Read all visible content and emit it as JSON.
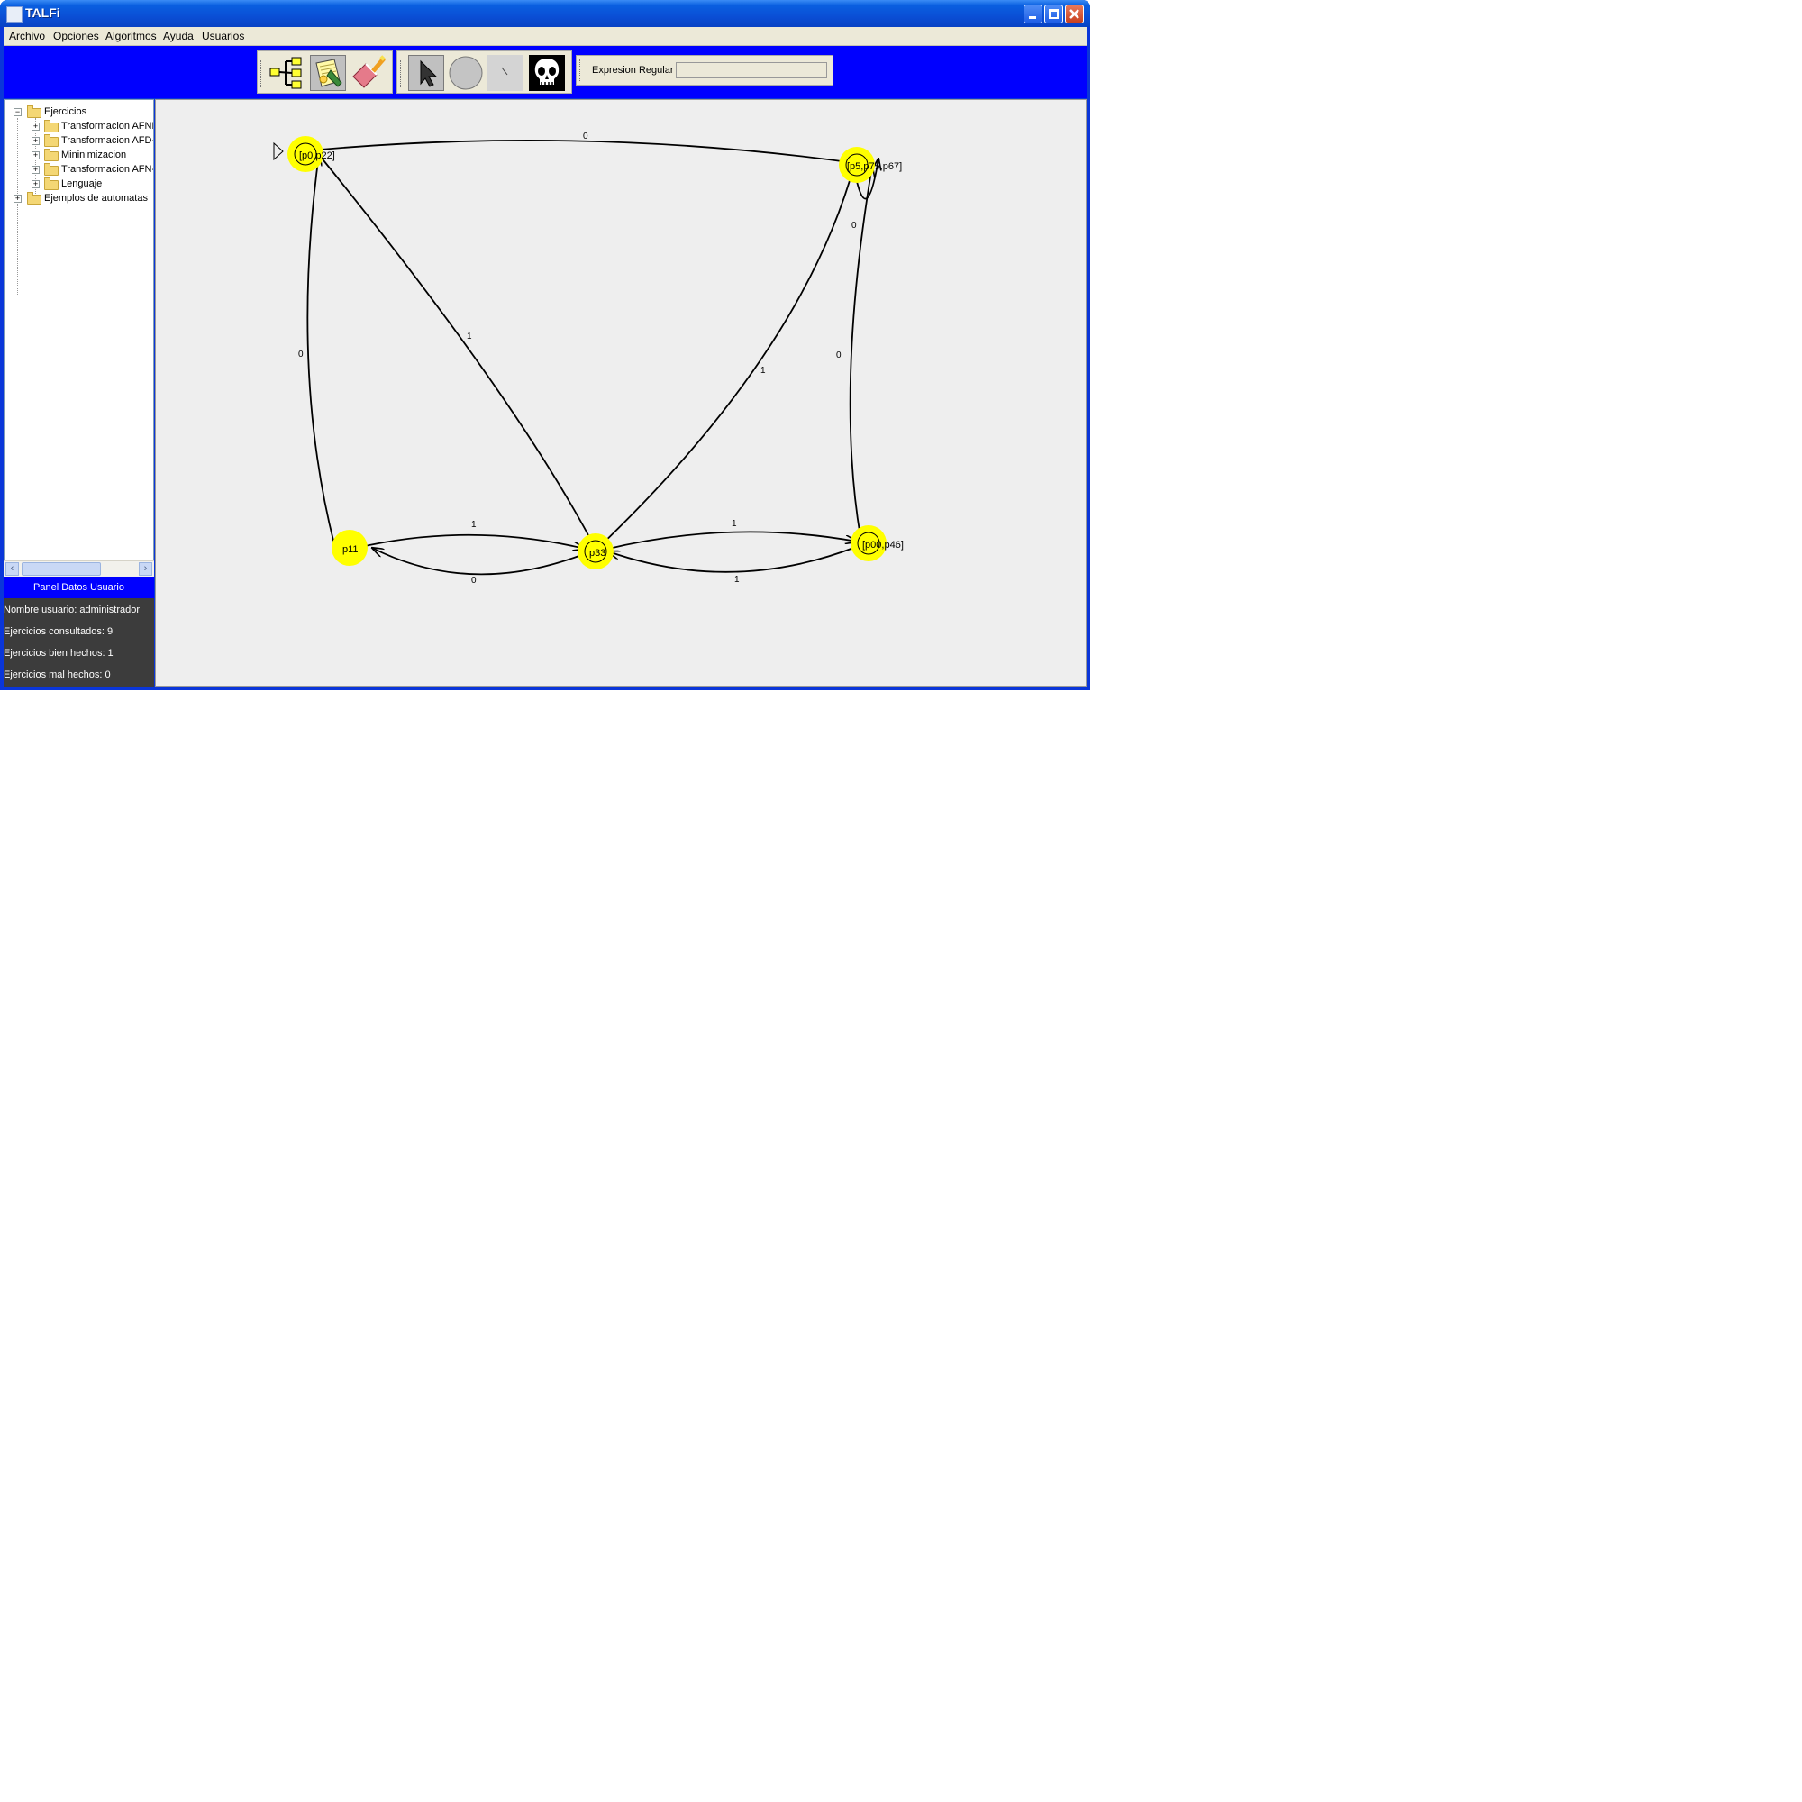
{
  "window": {
    "title": "TALFi"
  },
  "menu": [
    "Archivo",
    "Opciones",
    "Algoritmos",
    "Ayuda",
    "Usuarios"
  ],
  "toolbar": {
    "tools_group1": [
      "diagram-icon",
      "notepad-icon",
      "eraser-icon"
    ],
    "tools_group2": [
      "pointer-icon",
      "circle-state-icon",
      "line-transition-icon",
      "skull-icon"
    ]
  },
  "regex": {
    "label": "Expresion Regular",
    "value": ""
  },
  "tree": {
    "root": "Ejercicios",
    "children": [
      "Transformacion AFNL",
      "Transformacion AFD-",
      "Mininimizacion",
      "Transformacion AFN-",
      "Lenguaje"
    ],
    "second_root": "Ejemplos de automatas"
  },
  "user_panel": {
    "title": "Panel Datos Usuario",
    "nombre": "Nombre usuario: administrador",
    "consultados": "Ejercicios consultados: 9",
    "bien": "Ejercicios bien hechos: 1",
    "mal": "Ejercicios mal hechos: 0"
  },
  "automaton": {
    "initial_state": "[p0,p22]",
    "states": [
      {
        "id": "s1",
        "label": "[p0,p22]",
        "final": true,
        "initial": true
      },
      {
        "id": "s2",
        "label": "[p5,p75,p67]",
        "final": true,
        "initial": false
      },
      {
        "id": "s3",
        "label": "p11",
        "final": false,
        "initial": false
      },
      {
        "id": "s4",
        "label": "p33",
        "final": true,
        "initial": false
      },
      {
        "id": "s5",
        "label": "[p00,p46]",
        "final": true,
        "initial": false
      }
    ],
    "transitions": [
      {
        "from": "s1",
        "to": "s2",
        "symbol": "0"
      },
      {
        "from": "s1",
        "to": "s4",
        "symbol": "1"
      },
      {
        "from": "s3",
        "to": "s1",
        "symbol": "0"
      },
      {
        "from": "s2",
        "to": "s2",
        "symbol": "0"
      },
      {
        "from": "s2",
        "to": "s4",
        "symbol": "1"
      },
      {
        "from": "s5",
        "to": "s2",
        "symbol": "0"
      },
      {
        "from": "s3",
        "to": "s4",
        "symbol": "1"
      },
      {
        "from": "s4",
        "to": "s3",
        "symbol": "0"
      },
      {
        "from": "s4",
        "to": "s5",
        "symbol": "1"
      },
      {
        "from": "s5",
        "to": "s4",
        "symbol": "1"
      }
    ]
  },
  "colors": {
    "title_bar": "#0a4fd6",
    "toolbar_bg": "#0000ff",
    "state_fill": "#ffff00",
    "canvas_bg": "#eeeeee",
    "user_panel_bg": "#3c3c3c"
  }
}
